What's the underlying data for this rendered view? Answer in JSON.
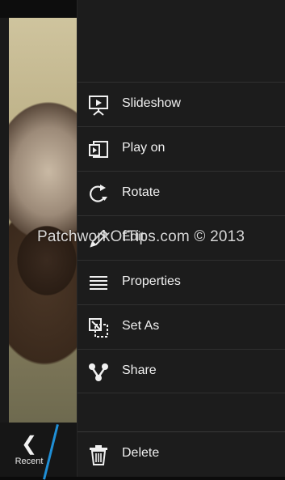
{
  "bottom_bar": {
    "recent_label": "Recent"
  },
  "menu": {
    "items": [
      {
        "label": "Slideshow",
        "icon": "slideshow-icon"
      },
      {
        "label": "Play on",
        "icon": "play-on-icon"
      },
      {
        "label": "Rotate",
        "icon": "rotate-icon"
      },
      {
        "label": "Edit",
        "icon": "edit-icon"
      },
      {
        "label": "Properties",
        "icon": "properties-icon"
      },
      {
        "label": "Set As",
        "icon": "set-as-icon"
      },
      {
        "label": "Share",
        "icon": "share-icon"
      }
    ],
    "delete": {
      "label": "Delete",
      "icon": "trash-icon"
    }
  },
  "watermark": "PatchworkOfTips.com © 2013",
  "colors": {
    "accent_blue": "#1f8fd6",
    "menu_bg": "#1c1c1c",
    "text": "#f0f0f0"
  }
}
